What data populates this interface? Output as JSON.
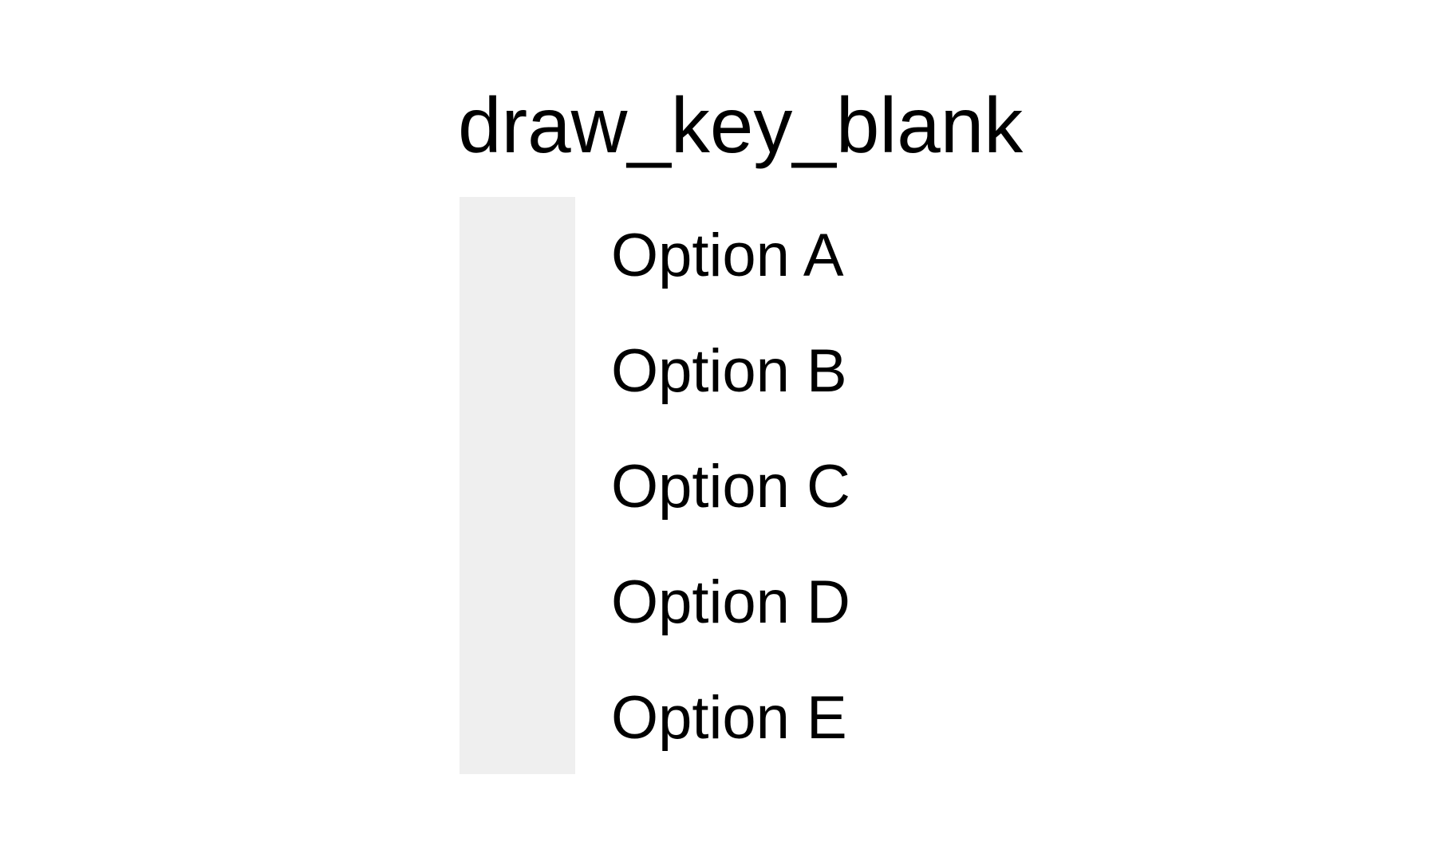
{
  "chart_data": {
    "type": "legend",
    "title": "draw_key_blank",
    "entries": [
      "Option A",
      "Option B",
      "Option C",
      "Option D",
      "Option E"
    ],
    "key_fill": "#efefef"
  }
}
